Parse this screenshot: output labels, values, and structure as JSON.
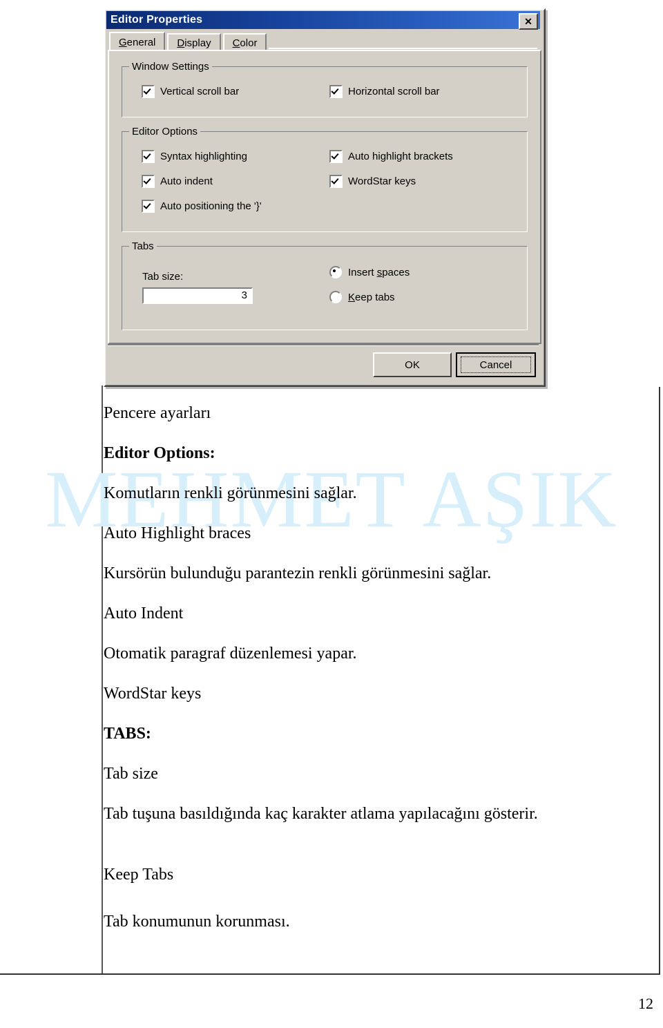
{
  "dialog": {
    "title": "Editor Properties",
    "close_icon": "close-icon",
    "close_glyph": "✕",
    "tabs": [
      {
        "label": "General",
        "accel": "G",
        "active": true
      },
      {
        "label": "Display",
        "accel": "D",
        "active": false
      },
      {
        "label": "Color",
        "accel": "C",
        "active": false
      }
    ],
    "groups": {
      "window_settings": {
        "title": "Window Settings",
        "checkboxes": [
          {
            "label": "Vertical scroll bar",
            "checked": true
          },
          {
            "label": "Horizontal scroll bar",
            "checked": true
          }
        ]
      },
      "editor_options": {
        "title": "Editor Options",
        "checkboxes": [
          {
            "label": "Syntax highlighting",
            "checked": true
          },
          {
            "label": "Auto highlight brackets",
            "checked": true
          },
          {
            "label": "Auto indent",
            "checked": true
          },
          {
            "label": "WordStar keys",
            "checked": true
          },
          {
            "label": "Auto positioning the '}'",
            "checked": true
          }
        ]
      },
      "tabs_group": {
        "title": "Tabs",
        "tab_size_label": "Tab size:",
        "tab_size_value": "3",
        "radios": [
          {
            "label": "Insert spaces",
            "accel": "s",
            "checked": true
          },
          {
            "label": "Keep tabs",
            "accel": "K",
            "checked": false
          }
        ]
      }
    },
    "buttons": {
      "ok": "OK",
      "cancel": "Cancel"
    },
    "colors": {
      "face": "#d4d0c8",
      "title_start": "#0a2a72",
      "title_end": "#3a74d6",
      "field": "#ffffff"
    }
  },
  "watermark": {
    "text": "MEHMET AŞIK",
    "color": "#d7eefb"
  },
  "document": {
    "lines": [
      {
        "text": "Pencere ayarları",
        "bold": false
      },
      {
        "text": "Editor Options:",
        "bold": true
      },
      {
        "text": "Komutların renkli görünmesini sağlar.",
        "bold": false
      },
      {
        "text": "Auto Highlight braces",
        "bold": false
      },
      {
        "text": "Kursörün bulunduğu parantezin renkli görünmesini sağlar.",
        "bold": false
      },
      {
        "text": "Auto Indent",
        "bold": false
      },
      {
        "text": "Otomatik paragraf düzenlemesi yapar.",
        "bold": false
      },
      {
        "text": "WordStar keys",
        "bold": false
      },
      {
        "text": "TABS:",
        "bold": true
      },
      {
        "text": "Tab size",
        "bold": false
      },
      {
        "text": "Tab tuşuna basıldığında kaç karakter atlama yapılacağını gösterir.",
        "bold": false
      },
      {
        "text": "Keep Tabs",
        "bold": false
      },
      {
        "text": "Tab konumunun korunması.",
        "bold": false
      }
    ],
    "page_number": "12"
  }
}
